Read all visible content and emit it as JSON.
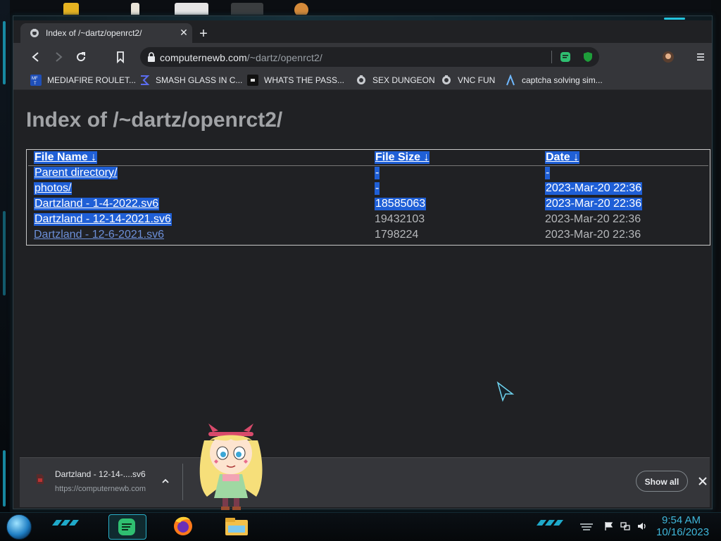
{
  "browser": {
    "tab": {
      "title": "Index of /~dartz/openrct2/"
    },
    "url": {
      "host": "computernewb.com",
      "path": "/~dartz/openrct2/"
    },
    "bookmarks": [
      {
        "label": "MEDIAFIRE ROULET...",
        "icon": "mediafire-icon"
      },
      {
        "label": "SMASH GLASS IN C...",
        "icon": "sigma-icon"
      },
      {
        "label": "WHATS THE PASS...",
        "icon": "dark-square-icon"
      },
      {
        "label": "SEX DUNGEON",
        "icon": "vnc-icon"
      },
      {
        "label": "VNC FUN",
        "icon": "vnc-icon"
      },
      {
        "label": "captcha solving sim...",
        "icon": "lambda-icon"
      }
    ]
  },
  "page": {
    "heading": "Index of /~dartz/openrct2/",
    "columns": {
      "name": "File Name  ↓",
      "size": "File Size  ↓",
      "date": "Date  ↓"
    },
    "rows": [
      {
        "name": "Parent directory/",
        "size": "-",
        "date": "-"
      },
      {
        "name": "photos/",
        "size": "-",
        "date": "2023-Mar-20 22:36"
      },
      {
        "name": "Dartzland - 1-4-2022.sv6",
        "size": "18585063",
        "date": "2023-Mar-20 22:36"
      },
      {
        "name": "Dartzland - 12-14-2021.sv6",
        "size": "19432103",
        "date": "2023-Mar-20 22:36"
      },
      {
        "name": "Dartzland - 12-6-2021.sv6",
        "size": "1798224",
        "date": "2023-Mar-20 22:36"
      }
    ]
  },
  "download_shelf": {
    "item": {
      "name": "Dartzland - 12-14-....sv6",
      "source": "https://computernewb.com"
    },
    "show_all": "Show all"
  },
  "taskbar": {
    "time": "9:54 AM",
    "date": "10/16/2023"
  },
  "colors": {
    "selection": "#1f5fd6",
    "link": "#6c8fd8",
    "clock": "#3fb6d9"
  }
}
